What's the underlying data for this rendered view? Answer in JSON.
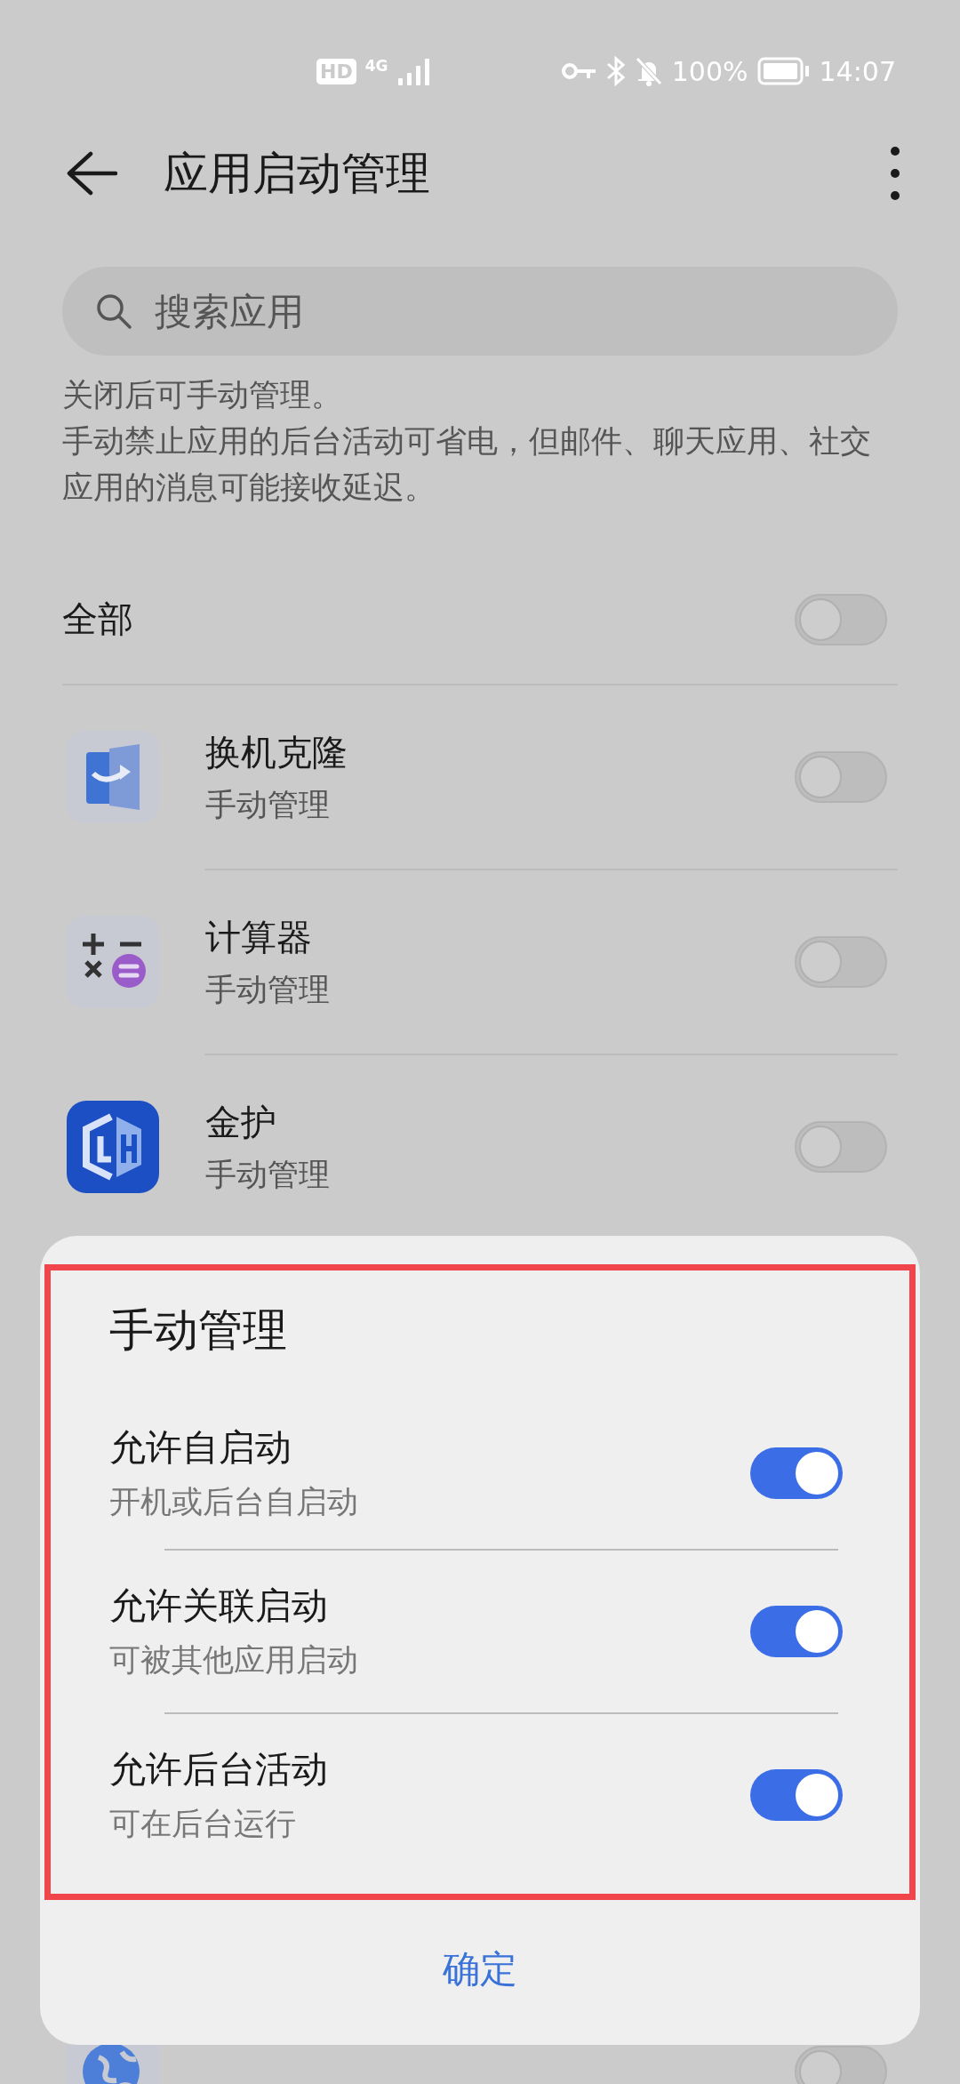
{
  "status_bar": {
    "hd": "HD",
    "network": "4G",
    "battery_percent": "100%",
    "time": "14:07"
  },
  "header": {
    "title": "应用启动管理"
  },
  "search": {
    "placeholder": "搜索应用"
  },
  "description": [
    "关闭后可手动管理。",
    "手动禁止应用的后台活动可省电，但邮件、聊天应用、社交应用的消息可能接收延迟。"
  ],
  "all_toggle": {
    "label": "全部",
    "on": false
  },
  "apps": [
    {
      "kind": "clone",
      "name": "换机克隆",
      "mode": "手动管理",
      "on": false
    },
    {
      "kind": "calculator",
      "name": "计算器",
      "mode": "手动管理",
      "on": false
    },
    {
      "kind": "shield",
      "name": "金护",
      "mode": "手动管理",
      "on": false
    },
    {
      "kind": "globe",
      "on": false
    }
  ],
  "dialog": {
    "title": "手动管理",
    "options": [
      {
        "title": "允许自启动",
        "subtitle": "开机或后台自启动",
        "on": true
      },
      {
        "title": "允许关联启动",
        "subtitle": "可被其他应用启动",
        "on": true
      },
      {
        "title": "允许后台活动",
        "subtitle": "可在后台运行",
        "on": true
      }
    ],
    "confirm": "确定"
  }
}
